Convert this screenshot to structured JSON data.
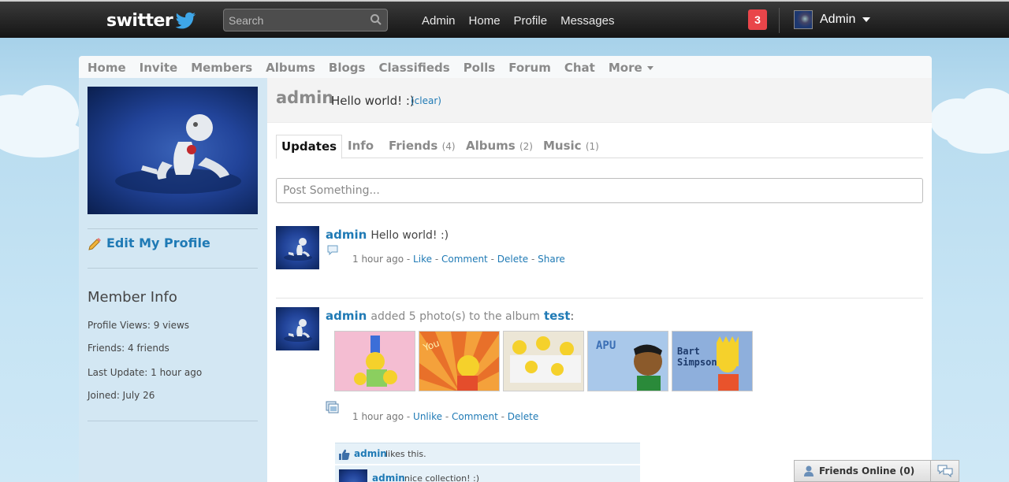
{
  "topbar": {
    "logo": "switter",
    "search_placeholder": "Search",
    "nav": [
      "Admin",
      "Home",
      "Profile",
      "Messages"
    ],
    "notifications": "3",
    "username": "Admin"
  },
  "mainnav": [
    "Home",
    "Invite",
    "Members",
    "Albums",
    "Blogs",
    "Classifieds",
    "Polls",
    "Forum",
    "Chat",
    "More"
  ],
  "sidebar": {
    "edit_profile": "Edit My Profile",
    "member_info_title": "Member Info",
    "info": [
      "Profile Views: 9 views",
      "Friends: 4 friends",
      "Last Update: 1 hour ago",
      "Joined: July 26"
    ]
  },
  "status": {
    "name": "admin",
    "text": "Hello world! :)",
    "clear": "(clear)"
  },
  "tabs": [
    {
      "label": "Updates",
      "count": ""
    },
    {
      "label": "Info",
      "count": ""
    },
    {
      "label": "Friends",
      "count": "(4)"
    },
    {
      "label": "Albums",
      "count": "(2)"
    },
    {
      "label": "Music",
      "count": "(1)"
    }
  ],
  "post_placeholder": "Post Something...",
  "feed": [
    {
      "name": "admin",
      "text": "Hello world! :)",
      "time": "1 hour ago",
      "actions": [
        "Like",
        "Comment",
        "Delete",
        "Share"
      ]
    },
    {
      "name": "admin",
      "text": "added 5 photo(s) to the album",
      "album": "test",
      "colon": ":",
      "time": "1 hour ago",
      "actions": [
        "Unlike",
        "Comment",
        "Delete"
      ],
      "photos": [
        {
          "label": "",
          "bg": "#f3b7cf"
        },
        {
          "label": "",
          "bg": "#f08a2b"
        },
        {
          "label": "",
          "bg": "#e8e2d0"
        },
        {
          "label": "APU",
          "bg": "#a9c8ea"
        },
        {
          "label": "Bart Simpson",
          "bg": "#87a9d8"
        }
      ],
      "likes": {
        "name": "admin",
        "text": "likes this."
      },
      "comment": {
        "name": "admin",
        "text": "nice collection! :)"
      }
    }
  ],
  "friends_online": "Friends Online (0)",
  "colors": {
    "link": "#1f7ab5",
    "notif": "#e9454a",
    "sidebar": "#d3e7f3"
  }
}
